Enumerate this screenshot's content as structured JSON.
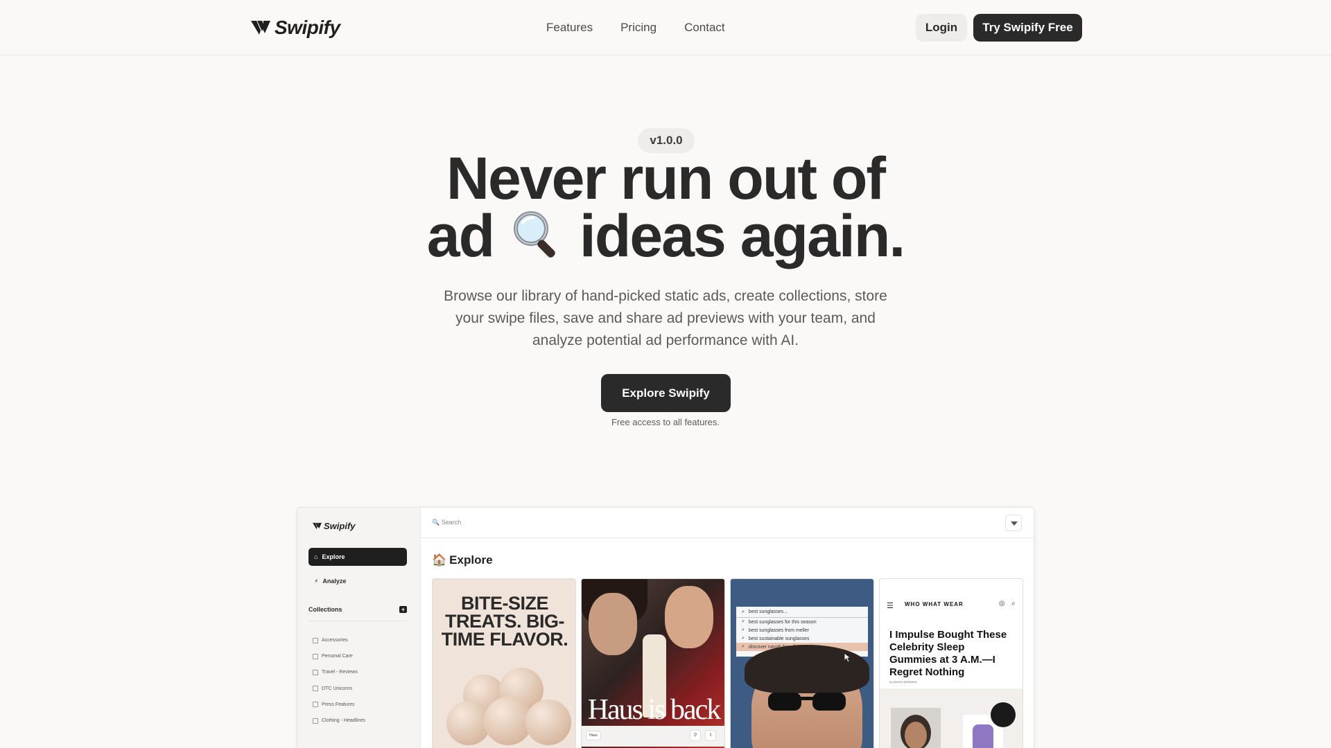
{
  "header": {
    "brand": "Swipify",
    "nav": [
      "Features",
      "Pricing",
      "Contact"
    ],
    "login_label": "Login",
    "cta_label": "Try Swipify Free"
  },
  "hero": {
    "version": "v1.0.0",
    "headline_line1": "Never run out of",
    "headline_line2_a": "ad",
    "headline_line2_b": "ideas again.",
    "subtitle": "Browse our library of hand-picked static ads, create collections, store your swipe files, save and share ad previews with your team, and analyze potential ad performance with AI.",
    "button_label": "Explore Swipify",
    "note": "Free access to all features."
  },
  "preview": {
    "brand": "Swipify",
    "sidebar": {
      "explore": "Explore",
      "analyze": "Analyze",
      "collections_label": "Collections",
      "collections": [
        "Accessories",
        "Personal Care",
        "Travel - Reviews",
        "DTC Unicorns",
        "Press Features",
        "Clothing - Headlines"
      ]
    },
    "search_placeholder": "Search",
    "page_title": "Explore",
    "cards": {
      "card1_text": "BITE-SIZE TREATS. BIG-TIME FLAVOR.",
      "card2_text": "Haus is back",
      "card2_chip": "Haus",
      "card3_queries": [
        "best sunglasses...",
        "best sunglasses for this season",
        "best sunglasses from meller",
        "best sustainable sunglasses",
        "discover nayah fog olive"
      ],
      "card4_brand": "WHO WHAT WEAR",
      "card4_title": "I Impulse Bought These Celebrity Sleep Gummies at 3 A.M.—I Regret Nothing",
      "card4_byline": "by ANIYAH MORINHA"
    }
  },
  "colors": {
    "background": "#fbf9f7",
    "primary_dark": "#2a2a2a",
    "pill": "#efedeb"
  }
}
